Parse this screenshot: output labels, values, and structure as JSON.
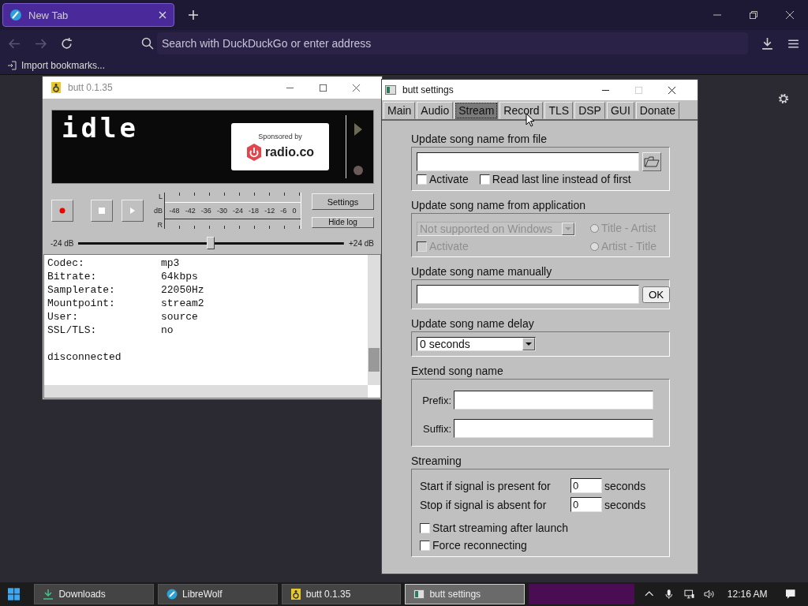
{
  "browser": {
    "tabs": [
      {
        "title": "New Tab",
        "selected": true
      }
    ],
    "address_placeholder": "Search with DuckDuckGo or enter address",
    "bookmarks": [
      "Import bookmarks..."
    ]
  },
  "butt": {
    "title": "butt 0.1.35",
    "status": "idle",
    "sponsor": "Sponsored by",
    "brand": "radio.co",
    "meter": {
      "left": "L",
      "unit": "dB",
      "right": "R",
      "ticks": [
        "-48",
        "-42",
        "-36",
        "-30",
        "-24",
        "-18",
        "-12",
        "-6",
        "0"
      ]
    },
    "buttons": [
      "Settings",
      "Hide log"
    ],
    "gain": {
      "min": "-24 dB",
      "max": "+24 dB",
      "level": 0.5
    },
    "log": {
      "fields": [
        {
          "key": "Codec:",
          "value": "mp3"
        },
        {
          "key": "Bitrate:",
          "value": "64kbps"
        },
        {
          "key": "Samplerate:",
          "value": "22050Hz"
        },
        {
          "key": "Mountpoint:",
          "value": "stream2"
        },
        {
          "key": "User:",
          "value": "source"
        },
        {
          "key": "SSL/TLS:",
          "value": "no"
        }
      ],
      "message": "disconnected"
    }
  },
  "settings": {
    "title": "butt settings",
    "tabs": [
      {
        "label": "Main",
        "selected": false
      },
      {
        "label": "Audio",
        "selected": false
      },
      {
        "label": "Stream",
        "selected": true
      },
      {
        "label": "Record",
        "selected": false
      },
      {
        "label": "TLS",
        "selected": false
      },
      {
        "label": "DSP",
        "selected": false
      },
      {
        "label": "GUI",
        "selected": false
      },
      {
        "label": "Donate",
        "selected": false
      }
    ],
    "file": {
      "heading": "Update song name from file",
      "options": [
        {
          "label": "Activate",
          "checked": false
        },
        {
          "label": "Read last line instead of first",
          "checked": false
        }
      ]
    },
    "application": {
      "heading": "Update song name from application",
      "dropdown": "Not supported on Windows",
      "disabled": true,
      "activate": {
        "label": "Activate",
        "checked": false
      },
      "orders": [
        {
          "label": "Title - Artist",
          "selected": false
        },
        {
          "label": "Artist - Title",
          "selected": false
        }
      ]
    },
    "manual": {
      "heading": "Update song name manually",
      "button": "OK"
    },
    "delay": {
      "heading": "Update song name delay",
      "value": "0 seconds"
    },
    "extend": {
      "heading": "Extend song name",
      "fields": [
        {
          "label": "Prefix:"
        },
        {
          "label": "Suffix:"
        }
      ]
    },
    "streaming": {
      "heading": "Streaming",
      "rows": [
        {
          "label": "Start if signal is present for",
          "value": "0",
          "unit": "seconds"
        },
        {
          "label": "Stop if signal is absent for",
          "value": "0",
          "unit": "seconds"
        }
      ],
      "options": [
        {
          "label": "Start streaming after launch",
          "checked": false
        },
        {
          "label": "Force reconnecting",
          "checked": false
        }
      ]
    }
  },
  "taskbar": {
    "items": [
      {
        "label": "Downloads",
        "kind": "download",
        "selected": false
      },
      {
        "label": "LibreWolf",
        "kind": "browser",
        "selected": false
      },
      {
        "label": "butt 0.1.35",
        "kind": "speaker",
        "selected": false
      },
      {
        "label": "butt settings",
        "kind": "window",
        "selected": true
      }
    ],
    "time": "12:16 AM"
  }
}
